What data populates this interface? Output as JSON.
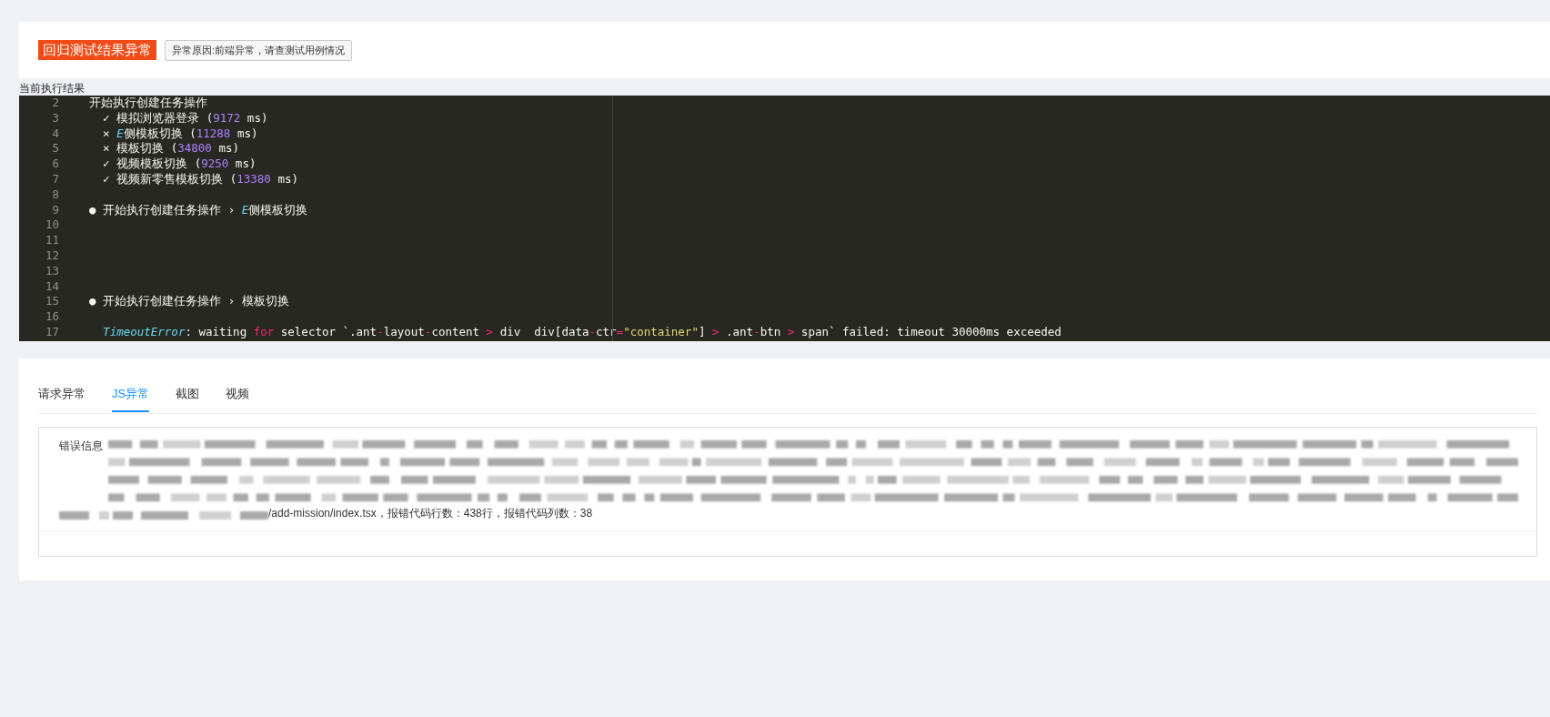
{
  "status": {
    "badge": "回归测试结果异常",
    "reason": "异常原因:前端异常，请查测试用例情况"
  },
  "result_title": "当前执行结果",
  "code": {
    "lines": [
      {
        "number": "2",
        "tokens": [
          {
            "kind": "text",
            "text": "  开始执行创建任务操作"
          }
        ]
      },
      {
        "number": "3",
        "tokens": [
          {
            "kind": "text",
            "text": "    ✓ 模拟浏览器登录 ("
          },
          {
            "kind": "number",
            "text": "9172"
          },
          {
            "kind": "text",
            "text": " ms)"
          }
        ]
      },
      {
        "number": "4",
        "tokens": [
          {
            "kind": "text",
            "text": "    × "
          },
          {
            "kind": "type",
            "text": "E"
          },
          {
            "kind": "text",
            "text": "侧模板切换 ("
          },
          {
            "kind": "number",
            "text": "11288"
          },
          {
            "kind": "text",
            "text": " ms)"
          }
        ]
      },
      {
        "number": "5",
        "tokens": [
          {
            "kind": "text",
            "text": "    × 模板切换 ("
          },
          {
            "kind": "number",
            "text": "34800"
          },
          {
            "kind": "text",
            "text": " ms)"
          }
        ]
      },
      {
        "number": "6",
        "tokens": [
          {
            "kind": "text",
            "text": "    ✓ 视频模板切换 ("
          },
          {
            "kind": "number",
            "text": "9250"
          },
          {
            "kind": "text",
            "text": " ms)"
          }
        ]
      },
      {
        "number": "7",
        "tokens": [
          {
            "kind": "text",
            "text": "    ✓ 视频新零售模板切换 ("
          },
          {
            "kind": "number",
            "text": "13380"
          },
          {
            "kind": "text",
            "text": " ms)"
          }
        ]
      },
      {
        "number": "8"
      },
      {
        "number": "9",
        "tokens": [
          {
            "kind": "text",
            "text": "  ● 开始执行创建任务操作 › "
          },
          {
            "kind": "type",
            "text": "E"
          },
          {
            "kind": "text",
            "text": "侧模板切换"
          }
        ]
      },
      {
        "number": "10"
      },
      {
        "number": "11"
      },
      {
        "number": "12"
      },
      {
        "number": "13"
      },
      {
        "number": "14"
      },
      {
        "number": "15",
        "tokens": [
          {
            "kind": "text",
            "text": "  ● 开始执行创建任务操作 › 模板切换"
          }
        ]
      },
      {
        "number": "16"
      },
      {
        "number": "17",
        "tokens": [
          {
            "kind": "type",
            "text": "    TimeoutError"
          },
          {
            "kind": "text",
            "text": ": waiting "
          },
          {
            "kind": "keyword",
            "text": "for"
          },
          {
            "kind": "text",
            "text": " selector `.ant"
          },
          {
            "kind": "op",
            "text": "-"
          },
          {
            "kind": "text",
            "text": "layout"
          },
          {
            "kind": "op",
            "text": "-"
          },
          {
            "kind": "text",
            "text": "content "
          },
          {
            "kind": "op",
            "text": ">"
          },
          {
            "kind": "text",
            "text": " div  div[data"
          },
          {
            "kind": "op",
            "text": "-"
          },
          {
            "kind": "text",
            "text": "ctr"
          },
          {
            "kind": "op",
            "text": "="
          },
          {
            "kind": "string",
            "text": "\"container\""
          },
          {
            "kind": "text",
            "text": "] "
          },
          {
            "kind": "op",
            "text": ">"
          },
          {
            "kind": "text",
            "text": " .ant"
          },
          {
            "kind": "op",
            "text": "-"
          },
          {
            "kind": "text",
            "text": "btn "
          },
          {
            "kind": "op",
            "text": ">"
          },
          {
            "kind": "text",
            "text": " span` failed: timeout 30000ms exceeded"
          }
        ]
      }
    ]
  },
  "tabs": [
    {
      "label": "请求异常",
      "selected": false
    },
    {
      "label": "JS异常",
      "selected": true
    },
    {
      "label": "截图",
      "selected": false
    },
    {
      "label": "视频",
      "selected": false
    }
  ],
  "error": {
    "label": "错误信息",
    "tail": "/add-mission/index.tsx，报错代码行数：438行，报错代码列数：38"
  }
}
